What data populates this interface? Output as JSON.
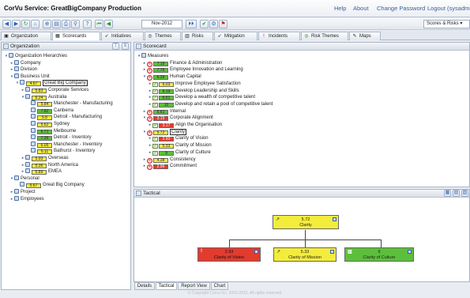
{
  "app": {
    "title": "CorVu Service: GreatBigCompany Production"
  },
  "top_links": {
    "help": "Help",
    "about": "About",
    "change_password": "Change Password",
    "logout": "Logout (sysadmi"
  },
  "toolbar": {
    "period": "Nov-2012",
    "period_nav": "⏵⏵",
    "view_select": "Scores & Risks ▾"
  },
  "tabs": [
    "Organization",
    "Scorecards",
    "Initiatives",
    "Themes",
    "Risks",
    "Mitigation",
    "Incidents",
    "Risk Themes",
    "Maps"
  ],
  "org_panel": {
    "title": "Organization",
    "rows": [
      {
        "text": "Organization Hierarchies",
        "level": 0,
        "twisty": "▾",
        "score": null,
        "color": null
      },
      {
        "text": "Company",
        "level": 1,
        "twisty": "▸",
        "score": null,
        "color": null
      },
      {
        "text": "Division",
        "level": 1,
        "twisty": "▸",
        "score": null,
        "color": null
      },
      {
        "text": "Business Unit",
        "level": 1,
        "twisty": "▾",
        "score": null,
        "color": null
      },
      {
        "text": "Great Big Company",
        "level": 2,
        "twisty": "▾",
        "score": "4.67",
        "color": "yellow",
        "selected": true
      },
      {
        "text": "Corporate Services",
        "level": 3,
        "twisty": "▸",
        "score": "5.83",
        "color": "yellow"
      },
      {
        "text": "Australia",
        "level": 3,
        "twisty": "▾",
        "score": "6.24",
        "color": "yellow"
      },
      {
        "text": "Manchester - Manufacturing",
        "level": 4,
        "twisty": "",
        "score": "5.84",
        "color": "yellow"
      },
      {
        "text": "Canberra",
        "level": 4,
        "twisty": "",
        "score": "7.82",
        "color": "green"
      },
      {
        "text": "Detroit - Manufacturing",
        "level": 4,
        "twisty": "",
        "score": "5.8",
        "color": "yellow"
      },
      {
        "text": "Sydney",
        "level": 4,
        "twisty": "",
        "score": "5.62",
        "color": "yellow"
      },
      {
        "text": "Melbourne",
        "level": 4,
        "twisty": "",
        "score": "6.71",
        "color": "green"
      },
      {
        "text": "Detroit - Inventory",
        "level": 4,
        "twisty": "",
        "score": "7.36",
        "color": "green"
      },
      {
        "text": "Manchester - Inventory",
        "level": 4,
        "twisty": "",
        "score": "6.05",
        "color": "yellow"
      },
      {
        "text": "Bathurst - Inventory",
        "level": 4,
        "twisty": "",
        "score": "6.11",
        "color": "yellow"
      },
      {
        "text": "Overseas",
        "level": 3,
        "twisty": "▸",
        "score": "5.93",
        "color": "yellow"
      },
      {
        "text": "North America",
        "level": 3,
        "twisty": "▸",
        "score": "5.36",
        "color": "yellow"
      },
      {
        "text": "EMEA",
        "level": 3,
        "twisty": "▸",
        "score": "5.89",
        "color": "yellow"
      },
      {
        "text": "Personal",
        "level": 1,
        "twisty": "▾",
        "score": null,
        "color": null
      },
      {
        "text": "Great Big Company",
        "level": 2,
        "twisty": "",
        "score": "5.67",
        "color": "yellow"
      },
      {
        "text": "Project",
        "level": 1,
        "twisty": "▸",
        "score": null,
        "color": null
      },
      {
        "text": "Employees",
        "level": 1,
        "twisty": "▸",
        "score": null,
        "color": null
      }
    ]
  },
  "scorecard_panel": {
    "title": "Scorecard",
    "rows": [
      {
        "text": "Measures",
        "level": 0,
        "twisty": "▾",
        "icon": "folder",
        "score": null,
        "color": null
      },
      {
        "text": "Finance & Administration",
        "level": 1,
        "twisty": "▸",
        "icon": "risk",
        "score": "7.19",
        "color": "green"
      },
      {
        "text": "Employee Innovation and Learning",
        "level": 1,
        "twisty": "▸",
        "icon": "risk",
        "score": "7.76",
        "color": "green"
      },
      {
        "text": "Human Capital",
        "level": 1,
        "twisty": "▾",
        "icon": "risk",
        "score": "6.39",
        "color": "green"
      },
      {
        "text": "Improve Employee Satisfaction",
        "level": 2,
        "twisty": "▸",
        "icon": "check",
        "score": "6.03",
        "color": "yellow"
      },
      {
        "text": "Develop Leadership and Skills",
        "level": 2,
        "twisty": "▸",
        "icon": "check",
        "score": "6.19",
        "color": "green"
      },
      {
        "text": "Develop a wealth of competitive talent",
        "level": 2,
        "twisty": "▸",
        "icon": "check",
        "score": "6.51",
        "color": "green"
      },
      {
        "text": "Develop and retain a pool of competitive talent",
        "level": 2,
        "twisty": "▸",
        "icon": "check",
        "score": "10",
        "color": "green"
      },
      {
        "text": "Internal",
        "level": 1,
        "twisty": "▸",
        "icon": "risk",
        "score": "6.61",
        "color": "green"
      },
      {
        "text": "Corporate Alignment",
        "level": 1,
        "twisty": "▾",
        "icon": "risk",
        "score": "3.15",
        "color": "red"
      },
      {
        "text": "Align the Organisation",
        "level": 2,
        "twisty": "▸",
        "icon": "check",
        "score": "3.17",
        "color": "red"
      },
      {
        "text": "Clarity",
        "level": 1,
        "twisty": "▾",
        "icon": "risk",
        "score": "5.72",
        "color": "yellow",
        "selected": true
      },
      {
        "text": "Clarity of Vision",
        "level": 2,
        "twisty": "▸",
        "icon": "check",
        "score": "2.93",
        "color": "red"
      },
      {
        "text": "Clarity of Mission",
        "level": 2,
        "twisty": "▸",
        "icon": "check",
        "score": "5.33",
        "color": "yellow"
      },
      {
        "text": "Clarity of Culture",
        "level": 2,
        "twisty": "▸",
        "icon": "check",
        "score": "9",
        "color": "green"
      },
      {
        "text": "Consistency",
        "level": 1,
        "twisty": "▸",
        "icon": "risk",
        "score": "4.38",
        "color": "yellow"
      },
      {
        "text": "Commitment",
        "level": 1,
        "twisty": "▸",
        "icon": "risk",
        "score": "2.96",
        "color": "red"
      }
    ]
  },
  "tactical_panel": {
    "title": "Tactical",
    "root": {
      "value": "5.72",
      "name": "Clarity",
      "color": "yellow"
    },
    "children": [
      {
        "value": "2.93",
        "name": "Clarity of Vision",
        "color": "red"
      },
      {
        "value": "5.33",
        "name": "Clarity of Mission",
        "color": "yellow"
      },
      {
        "value": "9",
        "name": "Clarity of Culture",
        "color": "green"
      }
    ]
  },
  "bottom_tabs": [
    "Details",
    "Tactical",
    "Report View",
    "Chart"
  ],
  "footer": {
    "text": "© Copyright Corvu Inc. 2003-2012. All rights reserved."
  },
  "colors": {
    "yellow": "#f4ec3c",
    "green": "#5cbf3c",
    "red": "#e33b2e",
    "header_blue": "#3a5f9a"
  }
}
